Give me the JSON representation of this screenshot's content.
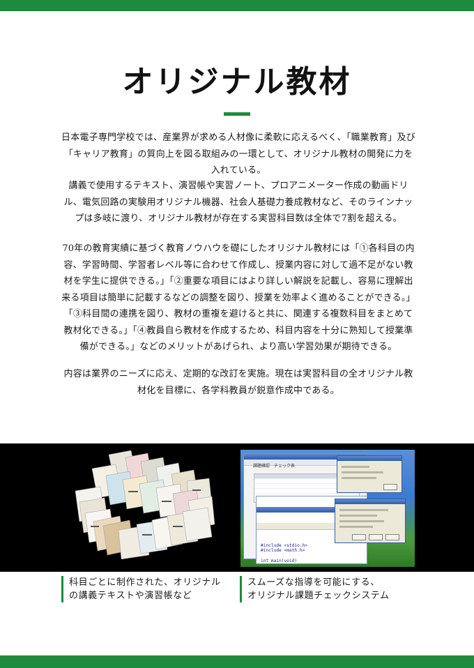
{
  "title": "オリジナル教材",
  "paragraphs": {
    "p1": "日本電子専門学校では、産業界が求める人材像に柔軟に応えるべく、「職業教育」及び「キャリア教育」の質向上を図る取組みの一環として、オリジナル教材の開発に力を入れている。",
    "p2": "講義で使用するテキスト、演習帳や実習ノート、プロアニメーター作成の動画ドリル、電気回路の実験用オリジナル機器、社会人基礎力養成教材など、そのラインナップは多岐に渡り、オリジナル教材が存在する実習科目数は全体で7割を超える。",
    "p3": "70年の教育実績に基づく教育ノウハウを礎にしたオリジナル教材には「①各科目の内容、学習時間、学習者レベル等に合わせて作成し、授業内容に対して過不足がない教材を学生に提供できる。」「②重要な項目にはより詳しい解説を記載し、容易に理解出来る項目は簡単に記載するなどの調整を図り、授業を効率よく進めることができる。」「③科目間の連携を図り、教材の重複を避けると共に、関連する複数科目をまとめて教材化できる。」「④教員自ら教材を作成するため、科目内容を十分に熟知して授業準備ができる。」などのメリットがあげられ、より高い学習効果が期待できる。",
    "p4": "内容は業界のニーズに応え、定期的な改訂を実施。現在は実習科目の全オリジナル教材化を目標に、各学科教員が鋭意作成中である。"
  },
  "captions": {
    "left": {
      "line1": "科目ごとに制作された、オリジナル",
      "line2": "の講義テキストや演習帳など"
    },
    "right": {
      "line1": "スムーズな指導を可能にする、",
      "line2": "オリジナル課題チェックシステム"
    }
  },
  "screenshot": {
    "tab_label": "課題確認　チェック表",
    "code": "#include <stdio.h>\n#include <math.h>\n\nint main(void)\n{\n  double x, y;\n  double z;\n\n  printf(\"x の y 乗の計算\\n\");\n  printf(\"x入力\");"
  },
  "colors": {
    "accent": "#1e8a3e",
    "photo_background": "#000000"
  }
}
